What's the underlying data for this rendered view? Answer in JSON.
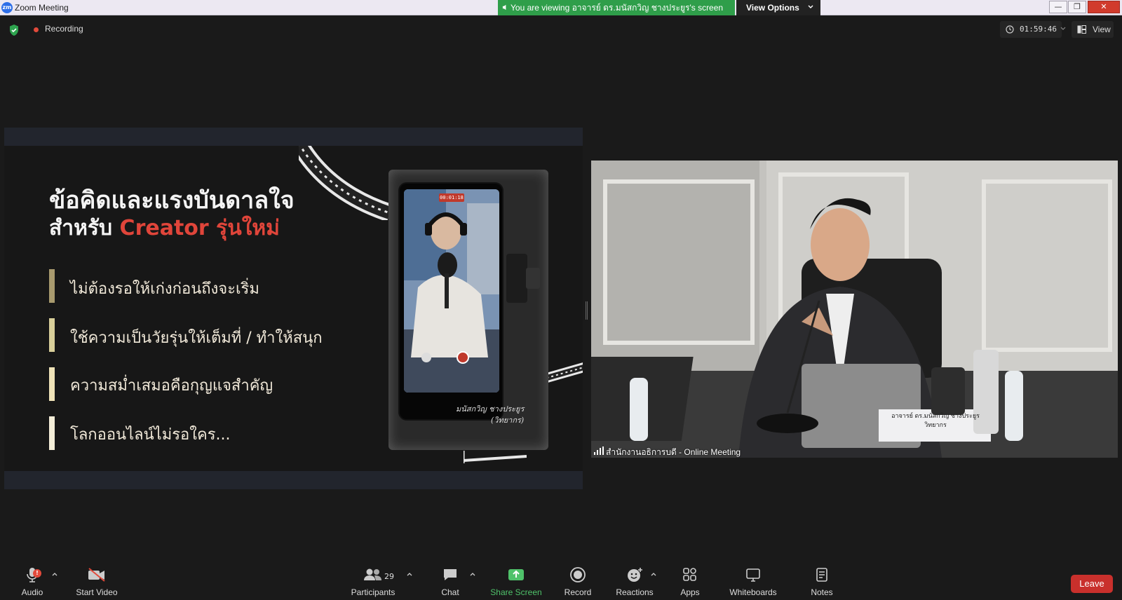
{
  "window": {
    "title": "Zoom Meeting",
    "logo_text": "zm",
    "viewing_banner": "You are viewing อาจารย์ ดร.มนัสกวิญ ชางประยูร's screen",
    "view_options_label": "View Options",
    "win_minimize": "—",
    "win_restore": "❐",
    "win_close": "✕"
  },
  "status": {
    "recording_label": "Recording",
    "timer": "01:59:46",
    "view_label": "View"
  },
  "slide": {
    "title_line1": "ข้อคิดและแรงบันดาลใจ",
    "title_line2_prefix": "สำหรับ ",
    "title_line2_accent": "Creator รุ่นใหม่",
    "bullets": [
      "ไม่ต้องรอให้เก่งก่อนถึงจะเริ่ม",
      "ใช้ความเป็นวัยรุ่นให้เต็มที่ / ทำให้สนุก",
      "ความสม่ำเสมอคือกุญแจสำคัญ",
      "โลกออนไลน์ไม่รอใคร..."
    ],
    "bullet_colors": [
      "#a89a6e",
      "#d9cf9a",
      "#efe3b8",
      "#f4eed8"
    ],
    "phone_timer": "00:01:18",
    "signature_line1": "มนัสกวิญ ชางประยูร",
    "signature_line2": "(วิทยากร)"
  },
  "video": {
    "participant_name": "สำนักงานอธิการบดี - Online Meeting",
    "nameplate_line1": "อาจารย์ ดร.มนัสกวิญ ชางประยูร",
    "nameplate_line2": "วิทยากร"
  },
  "toolbar": {
    "audio": "Audio",
    "audio_badge": "!",
    "start_video": "Start Video",
    "participants": "Participants",
    "participants_count": "29",
    "chat": "Chat",
    "share_screen": "Share Screen",
    "record": "Record",
    "reactions": "Reactions",
    "apps": "Apps",
    "whiteboards": "Whiteboards",
    "notes": "Notes",
    "leave": "Leave"
  },
  "colors": {
    "accent_red": "#e0453a",
    "share_green": "#4fc26a",
    "banner_green": "#2f9e4a",
    "leave_red": "#c9302c"
  }
}
